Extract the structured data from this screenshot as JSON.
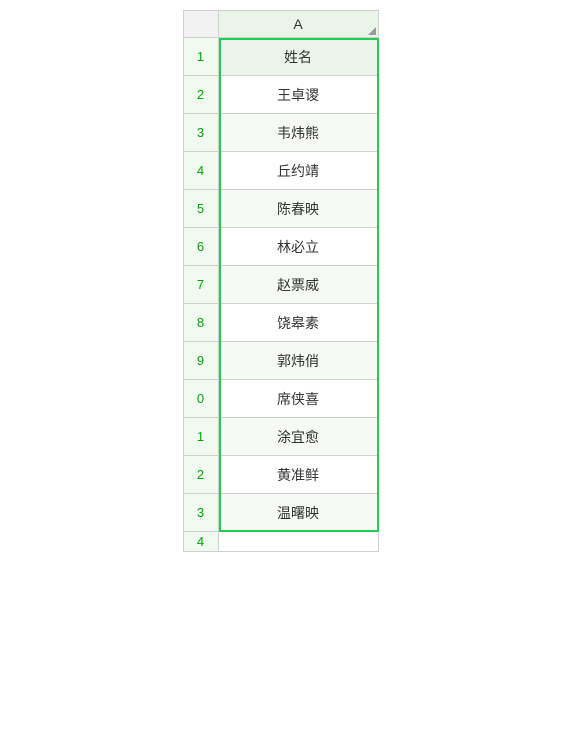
{
  "sheet": {
    "column_header": "A",
    "row_header": "姓名",
    "rows": [
      {
        "num": "1",
        "value": "姓名",
        "is_header": true
      },
      {
        "num": "2",
        "value": "王卓谡",
        "is_header": false
      },
      {
        "num": "3",
        "value": "韦炜熊",
        "is_header": false
      },
      {
        "num": "4",
        "value": "丘约靖",
        "is_header": false
      },
      {
        "num": "5",
        "value": "陈春映",
        "is_header": false
      },
      {
        "num": "6",
        "value": "林必立",
        "is_header": false
      },
      {
        "num": "7",
        "value": "赵票威",
        "is_header": false
      },
      {
        "num": "8",
        "value": "饶皋素",
        "is_header": false
      },
      {
        "num": "9",
        "value": "郭炜俏",
        "is_header": false
      },
      {
        "num": "0",
        "value": "席侠喜",
        "is_header": false
      },
      {
        "num": "1",
        "value": "涂宜愈",
        "is_header": false
      },
      {
        "num": "2",
        "value": "黄准鲜",
        "is_header": false
      },
      {
        "num": "3",
        "value": "温曙映",
        "is_header": false
      }
    ],
    "bottom_row_num": "4"
  }
}
